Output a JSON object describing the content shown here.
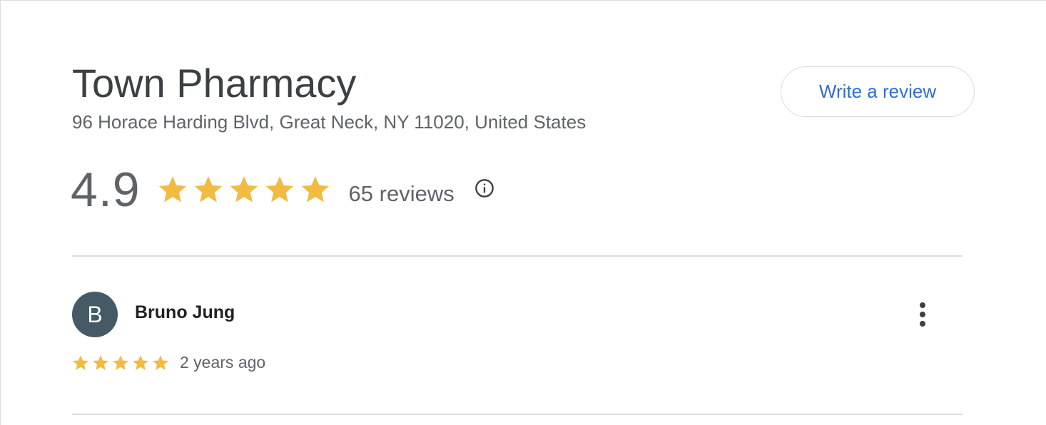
{
  "place": {
    "title": "Town Pharmacy",
    "address": "96 Horace Harding Blvd, Great Neck, NY 11020, United States"
  },
  "actions": {
    "write_review_label": "Write a review"
  },
  "rating": {
    "value": "4.9",
    "stars": 5,
    "review_count_label": "65 reviews",
    "info_icon": "info-icon"
  },
  "reviews": [
    {
      "avatar_initial": "B",
      "name": "Bruno Jung",
      "stars": 5,
      "time": "2 years ago",
      "menu_icon": "more-vert-icon"
    }
  ],
  "colors": {
    "star": "#f2bb41",
    "link": "#1a73e8",
    "avatar_bg": "#455a64",
    "divider": "#dadce0"
  }
}
